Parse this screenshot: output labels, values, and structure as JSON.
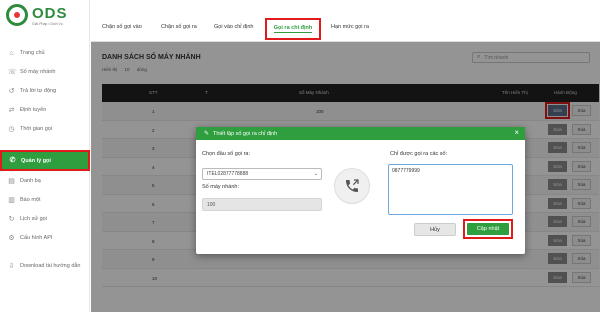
{
  "app": {
    "logo_text": "ODS",
    "logo_subtitle": "Giải Pháp • Dịch Vụ"
  },
  "sidebar": {
    "items": [
      {
        "label": "Trang chủ",
        "icon": "home-icon"
      },
      {
        "label": "Số máy nhánh",
        "icon": "phone-icon"
      },
      {
        "label": "Trả lời tự động",
        "icon": "reply-icon"
      },
      {
        "label": "Định tuyến",
        "icon": "route-icon"
      },
      {
        "label": "Thời gian gọi",
        "icon": "clock-icon"
      },
      {
        "label": "Quản lý gọi",
        "icon": "phone-icon"
      },
      {
        "label": "Danh bạ",
        "icon": "contacts-icon"
      },
      {
        "label": "Báo một",
        "icon": "chart-icon"
      },
      {
        "label": "Lịch sử gọi",
        "icon": "history-icon"
      },
      {
        "label": "Cấu hình API",
        "icon": "api-icon"
      },
      {
        "label": "Download tài hướng dẫn",
        "icon": "download-icon"
      }
    ]
  },
  "tabs": [
    {
      "label": "Chặn số gọi vào"
    },
    {
      "label": "Chặn số gọi ra"
    },
    {
      "label": "Gọi vào chỉ định"
    },
    {
      "label": "Gọi ra chỉ định"
    },
    {
      "label": "Hạn mức gọi ra"
    }
  ],
  "page": {
    "title": "DANH SÁCH SỐ MÁY NHÁNH",
    "filter_label": "Hiển thị",
    "filter_value": "10",
    "filter_suffix": "dòng",
    "search_placeholder": "Tìm nhanh"
  },
  "table": {
    "headers": [
      "STT",
      "T",
      "Số Máy Nhánh",
      "Tên Hiển Thị",
      "Hành Động"
    ],
    "rows": [
      {
        "stt": "1",
        "number": "100"
      },
      {
        "stt": "2",
        "number": ""
      },
      {
        "stt": "3",
        "number": ""
      },
      {
        "stt": "4",
        "number": ""
      },
      {
        "stt": "5",
        "number": ""
      },
      {
        "stt": "6",
        "number": ""
      },
      {
        "stt": "7",
        "number": ""
      },
      {
        "stt": "8",
        "number": ""
      },
      {
        "stt": "9",
        "number": ""
      },
      {
        "stt": "10",
        "number": ""
      }
    ],
    "edit_label": "Sửa",
    "delete_label": "Xóa"
  },
  "modal": {
    "title": "Thiết lập số gọi ra chỉ định",
    "close": "×",
    "prefix_label": "Chọn đầu số gọi ra:",
    "prefix_value": "ITEL02877778888",
    "extension_label": "Số máy nhánh:",
    "extension_value": "100",
    "allowed_label": "Chỉ được gọi ra các số:",
    "allowed_value": "0877779999",
    "cancel_label": "Hủy",
    "update_label": "Cập nhật"
  },
  "colors": {
    "brand_green": "#2e9e3f",
    "highlight_red": "#e01b1b"
  }
}
